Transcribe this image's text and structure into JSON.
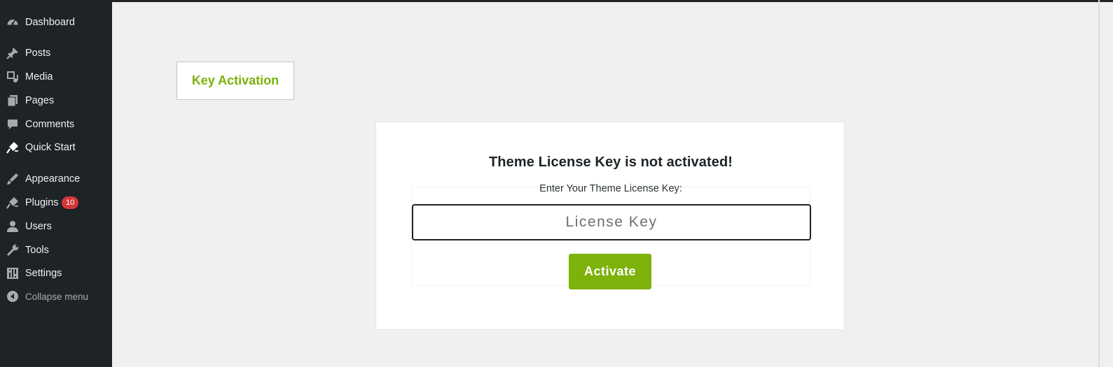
{
  "sidebar": {
    "items": [
      {
        "label": "Dashboard",
        "icon": "dashboard-icon"
      },
      {
        "label": "Posts",
        "icon": "pin-icon"
      },
      {
        "label": "Media",
        "icon": "media-icon"
      },
      {
        "label": "Pages",
        "icon": "pages-icon"
      },
      {
        "label": "Comments",
        "icon": "comment-icon"
      },
      {
        "label": "Quick Start",
        "icon": "plugin-icon"
      },
      {
        "label": "Appearance",
        "icon": "brush-icon"
      },
      {
        "label": "Plugins",
        "icon": "plugin-icon",
        "badge": "10"
      },
      {
        "label": "Users",
        "icon": "user-icon"
      },
      {
        "label": "Tools",
        "icon": "wrench-icon"
      },
      {
        "label": "Settings",
        "icon": "settings-icon"
      },
      {
        "label": "Collapse menu",
        "icon": "collapse-icon"
      }
    ]
  },
  "tab": {
    "label": "Key Activation"
  },
  "card": {
    "title": "Theme License Key is not activated!",
    "field_label": "Enter Your Theme License Key:",
    "input_placeholder": "License Key",
    "input_value": "",
    "button_label": "Activate"
  },
  "colors": {
    "sidebar_bg": "#1d2327",
    "accent": "#7cb20a",
    "badge": "#d63638",
    "page_bg": "#f0f0f1"
  }
}
